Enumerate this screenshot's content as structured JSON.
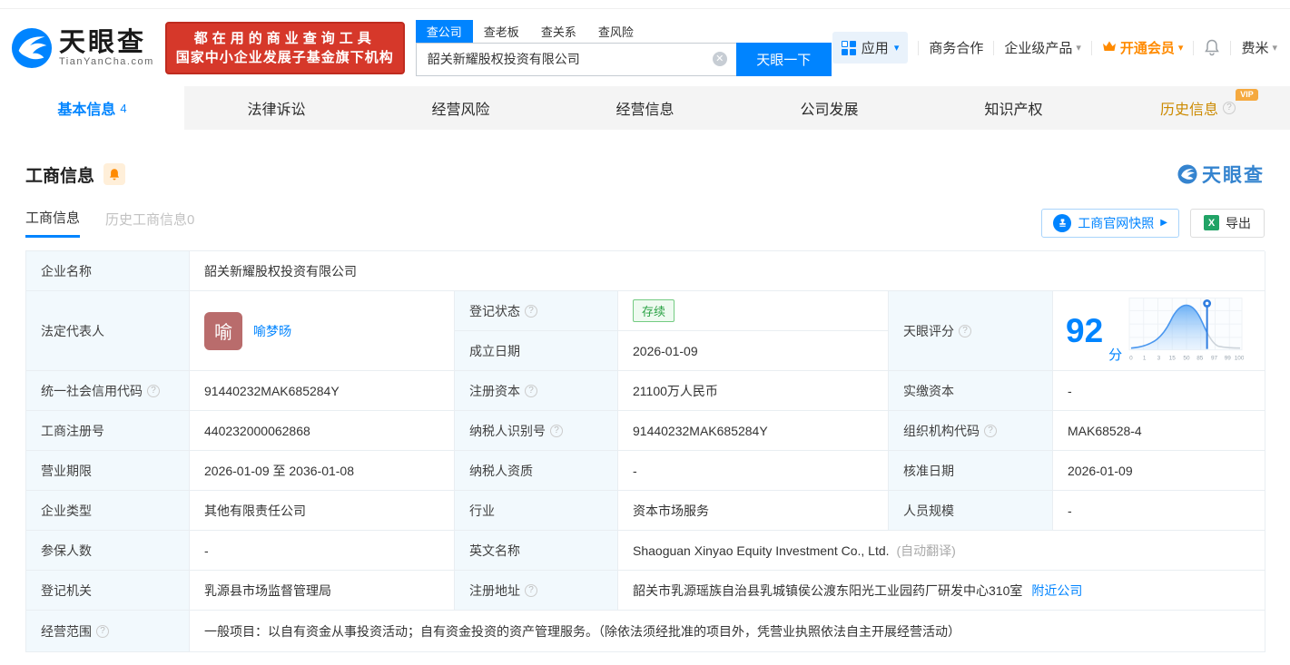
{
  "colors": {
    "primary": "#0084ff",
    "banner_red": "#d6382a",
    "vip_orange": "#ff8a00",
    "status_green": "#2ba245"
  },
  "header": {
    "logo_brand": "天眼查",
    "logo_domain": "TianYanCha.com",
    "slogan_line1": "都在用的商业查询工具",
    "slogan_line2": "国家中小企业发展子基金旗下机构",
    "search_tabs": [
      "查公司",
      "查老板",
      "查关系",
      "查风险"
    ],
    "search_value": "韶关新耀股权投资有限公司",
    "search_button": "天眼一下",
    "menu_apps": "应用",
    "menu_cooperation": "商务合作",
    "menu_enterprise": "企业级产品",
    "menu_vip": "开通会员",
    "menu_user": "费米"
  },
  "nav": {
    "tabs": [
      "基本信息",
      "法律诉讼",
      "经营风险",
      "经营信息",
      "公司发展",
      "知识产权",
      "历史信息"
    ],
    "basic_count": "4",
    "vip_badge": "VIP"
  },
  "section": {
    "title": "工商信息",
    "subtab_current": "工商信息",
    "subtab_history": "历史工商信息0",
    "watermark": "天眼查",
    "snapshot_button": "工商官网快照",
    "export_button": "导出"
  },
  "table": {
    "row_name": {
      "label": "企业名称",
      "value": "韶关新耀股权投资有限公司"
    },
    "row_legal": {
      "label": "法定代表人",
      "avatar_char": "喻",
      "name": "喻梦旸",
      "status_label": "登记状态",
      "status_value": "存续",
      "date_label": "成立日期",
      "date_value": "2026-01-09"
    },
    "score": {
      "label": "天眼评分",
      "value": "92",
      "unit": "分"
    },
    "rows": [
      {
        "l1": "统一社会信用代码",
        "v1": "91440232MAK685284Y",
        "l2": "注册资本",
        "v2": "21100万人民币",
        "l3": "实缴资本",
        "v3": "-"
      },
      {
        "l1": "工商注册号",
        "v1": "440232000062868",
        "l2": "纳税人识别号",
        "v2": "91440232MAK685284Y",
        "l3": "组织机构代码",
        "v3": "MAK68528-4"
      },
      {
        "l1": "营业期限",
        "v1": "2026-01-09 至 2036-01-08",
        "l2": "纳税人资质",
        "v2": "-",
        "l3": "核准日期",
        "v3": "2026-01-09"
      },
      {
        "l1": "企业类型",
        "v1": "其他有限责任公司",
        "l2": "行业",
        "v2": "资本市场服务",
        "l3": "人员规模",
        "v3": "-"
      }
    ],
    "row_insured": {
      "l1": "参保人数",
      "v1": "-",
      "l2": "英文名称",
      "v2": "Shaoguan Xinyao Equity Investment Co., Ltd.",
      "note": "(自动翻译)"
    },
    "row_registry": {
      "l1": "登记机关",
      "v1": "乳源县市场监督管理局",
      "l2": "注册地址",
      "v2": "韶关市乳源瑶族自治县乳城镇侯公渡东阳光工业园药厂研发中心310室",
      "link": "附近公司"
    },
    "row_scope": {
      "label": "经营范围",
      "value": "一般项目：以自有资金从事投资活动；自有资金投资的资产管理服务。（除依法须经批准的项目外，凭营业执照依法自主开展经营活动）"
    }
  },
  "chart_data": {
    "type": "area",
    "title": "天眼评分分布曲线",
    "score": 92,
    "marker_value": 92,
    "x_ticks": [
      "0",
      "1",
      "3",
      "15",
      "50",
      "85",
      "97",
      "99",
      "100"
    ],
    "legend_position": "none",
    "grid": true
  }
}
